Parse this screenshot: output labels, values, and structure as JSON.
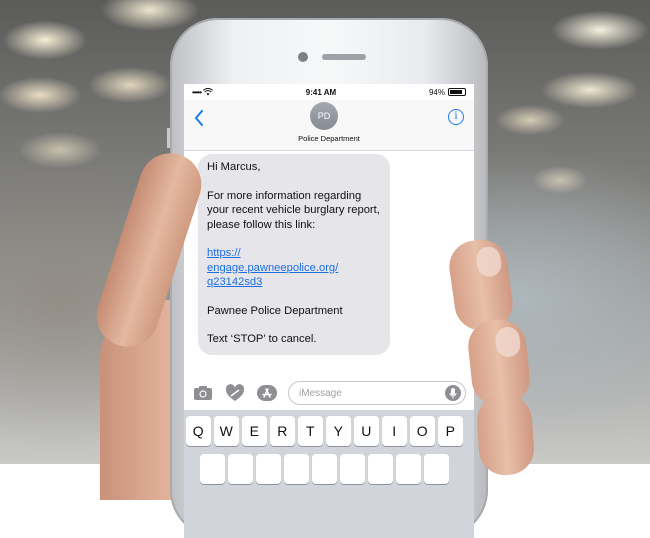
{
  "status_bar": {
    "carrier_dots": "•••••",
    "time": "9:41 AM",
    "battery": "94%"
  },
  "header": {
    "back_icon": "chevron-left-icon",
    "avatar_initials": "PD",
    "contact_name": "Police Department",
    "info_icon": "info-icon"
  },
  "message": {
    "greeting": "Hi Marcus,",
    "body": "For more information regarding your recent vehicle burglary report, please follow this link:",
    "link": "https://engage.pawneepolice.org/q23142sd3",
    "link_lines": [
      "https://",
      "engage.pawneepolice.org/",
      "q23142sd3"
    ],
    "signature": "Pawnee Police Department",
    "footer": "Text ‘STOP’ to cancel."
  },
  "input_bar": {
    "placeholder": "iMessage",
    "icons": [
      "camera-icon",
      "heart-hands-icon",
      "app-store-icon",
      "microphone-icon"
    ]
  },
  "keyboard": {
    "row1": [
      "Q",
      "W",
      "E",
      "R",
      "T",
      "Y",
      "U",
      "I",
      "O",
      "P"
    ]
  },
  "colors": {
    "link": "#1d6fe0",
    "bubble": "#e5e5ea",
    "ios_blue": "#1e7cf2"
  }
}
